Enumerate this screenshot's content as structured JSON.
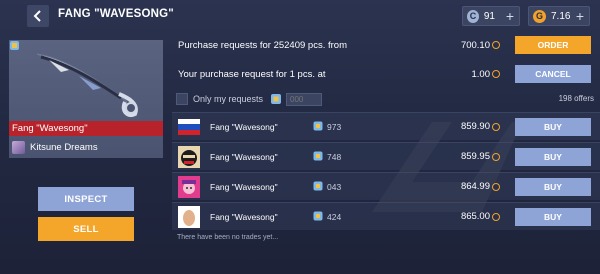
{
  "header": {
    "title": "FANG \"WAVESONG\"",
    "silver": {
      "value": "91",
      "icon": "silver-coin-icon"
    },
    "gold": {
      "value": "7.16",
      "icon": "gold-coin-icon"
    }
  },
  "item": {
    "name": "Fang \"Wavesong\"",
    "collection": "Kitsune Dreams",
    "rarity_color": "#b8232b"
  },
  "actions": {
    "inspect": "INSPECT",
    "sell": "SELL"
  },
  "requests": {
    "purchase_text": "Purchase requests for 252409 pcs. from",
    "purchase_price": "700.10",
    "order_label": "ORDER",
    "your_text": "Your purchase request for 1 pcs. at",
    "your_price": "1.00",
    "cancel_label": "CANCEL"
  },
  "filter": {
    "only_mine_label": "Only my requests",
    "float_placeholder": "000",
    "offers_count": "198 offers"
  },
  "offers": [
    {
      "name": "Fang \"Wavesong\"",
      "float": "973",
      "price": "859.90",
      "buy": "BUY",
      "avatar": "russia-flag"
    },
    {
      "name": "Fang \"Wavesong\"",
      "float": "748",
      "price": "859.95",
      "buy": "BUY",
      "avatar": "masked-character"
    },
    {
      "name": "Fang \"Wavesong\"",
      "float": "043",
      "price": "864.99",
      "buy": "BUY",
      "avatar": "pink-anime-character"
    },
    {
      "name": "Fang \"Wavesong\"",
      "float": "424",
      "price": "865.00",
      "buy": "BUY",
      "avatar": "egg"
    }
  ],
  "trades_note": "There have been no trades yet...",
  "colors": {
    "accent_orange": "#f4a62a",
    "accent_blue": "#8ea3d6",
    "rarity_red": "#b8232b"
  }
}
